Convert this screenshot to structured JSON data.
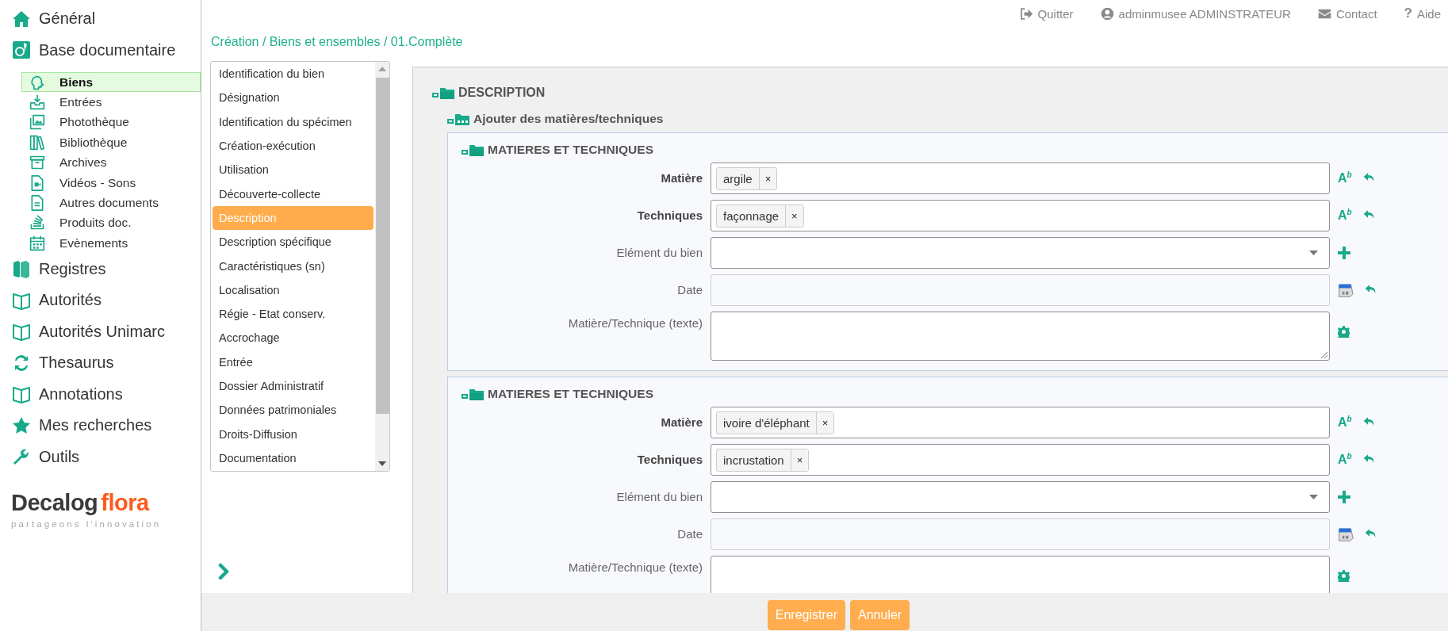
{
  "header": {
    "links": [
      {
        "label": "Quitter"
      },
      {
        "label": "adminmusee ADMINSTRATEUR"
      },
      {
        "label": "Contact"
      },
      {
        "label": "Aide",
        "glyph": "?"
      }
    ]
  },
  "sidebar": {
    "items": [
      {
        "label": "Général",
        "selected": false
      },
      {
        "label": "Base documentaire",
        "selected": false,
        "children": [
          {
            "label": "Biens",
            "selected": true
          },
          {
            "label": "Entrées",
            "selected": false
          },
          {
            "label": "Photothèque",
            "selected": false
          },
          {
            "label": "Bibliothèque",
            "selected": false
          },
          {
            "label": "Archives",
            "selected": false
          },
          {
            "label": "Vidéos - Sons",
            "selected": false
          },
          {
            "label": "Autres documents",
            "selected": false
          },
          {
            "label": "Produits doc.",
            "selected": false
          },
          {
            "label": "Evènements",
            "selected": false
          }
        ]
      },
      {
        "label": "Registres",
        "selected": false
      },
      {
        "label": "Autorités",
        "selected": false
      },
      {
        "label": "Autorités Unimarc",
        "selected": false
      },
      {
        "label": "Thesaurus",
        "selected": false
      },
      {
        "label": "Annotations",
        "selected": false
      },
      {
        "label": "Mes recherches",
        "selected": false
      },
      {
        "label": "Outils",
        "selected": false
      }
    ]
  },
  "logo": {
    "name": "Decalog",
    "accent": "flora",
    "tagline": "partageons l'innovation"
  },
  "breadcrumb": "Création / Biens et ensembles / 01.Complète",
  "section_list": {
    "items": [
      {
        "label": "Identification du bien",
        "selected": false
      },
      {
        "label": "Désignation",
        "selected": false
      },
      {
        "label": "Identification du spécimen",
        "selected": false
      },
      {
        "label": "Création-exécution",
        "selected": false
      },
      {
        "label": "Utilisation",
        "selected": false
      },
      {
        "label": "Découverte-collecte",
        "selected": false
      },
      {
        "label": "Description",
        "selected": true
      },
      {
        "label": "Description spécifique",
        "selected": false
      },
      {
        "label": "Caractéristiques (sn)",
        "selected": false
      },
      {
        "label": "Localisation",
        "selected": false
      },
      {
        "label": "Régie - Etat conserv.",
        "selected": false
      },
      {
        "label": "Accrochage",
        "selected": false
      },
      {
        "label": "Entrée",
        "selected": false
      },
      {
        "label": "Dossier Administratif",
        "selected": false
      },
      {
        "label": "Données patrimoniales",
        "selected": false
      },
      {
        "label": "Droits-Diffusion",
        "selected": false
      },
      {
        "label": "Documentation",
        "selected": false
      }
    ]
  },
  "form": {
    "title": "DESCRIPTION",
    "subtitle": "Ajouter des matières/techniques",
    "groups": [
      {
        "title": "MATIERES ET TECHNIQUES",
        "fields": [
          {
            "label": "Matière",
            "required": true,
            "kind": "tags",
            "tags": [
              {
                "label": "argile",
                "remove": "×"
              }
            ],
            "format_glyph": "A$^{b}$"
          },
          {
            "label": "Techniques",
            "required": true,
            "kind": "tags",
            "tags": [
              {
                "label": "façonnage",
                "remove": "×"
              }
            ],
            "format_glyph": "A$^{b}$"
          },
          {
            "label": "Elément du bien",
            "required": false,
            "kind": "select"
          },
          {
            "label": "Date",
            "required": false,
            "kind": "date"
          },
          {
            "label": "Matière/Technique (texte)",
            "required": false,
            "kind": "textarea"
          }
        ]
      },
      {
        "title": "MATIERES ET TECHNIQUES",
        "fields": [
          {
            "label": "Matière",
            "required": true,
            "kind": "tags",
            "tags": [
              {
                "label": "ivoire d'éléphant",
                "remove": "×"
              }
            ],
            "format_glyph": "A$^{b}$"
          },
          {
            "label": "Techniques",
            "required": true,
            "kind": "tags",
            "tags": [
              {
                "label": "incrustation",
                "remove": "×"
              }
            ],
            "format_glyph": "A$^{b}$"
          },
          {
            "label": "Elément du bien",
            "required": false,
            "kind": "select"
          },
          {
            "label": "Date",
            "required": false,
            "kind": "date"
          },
          {
            "label": "Matière/Technique (texte)",
            "required": false,
            "kind": "textarea"
          }
        ]
      }
    ]
  },
  "buttons": [
    {
      "label": "Enregistrer"
    },
    {
      "label": "Annuler"
    }
  ]
}
